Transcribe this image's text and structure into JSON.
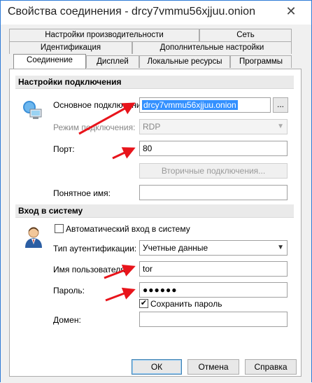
{
  "window": {
    "title": "Свойства соединения - drcy7vmmu56xjjuu.onion",
    "close_glyph": "✕"
  },
  "tabs_row1": [
    {
      "label": "Настройки производительности"
    },
    {
      "label": "Сеть"
    }
  ],
  "tabs_row2": [
    {
      "label": "Идентификация"
    },
    {
      "label": "Дополнительные настройки"
    }
  ],
  "tabs_row3": [
    {
      "label": "Соединение",
      "active": true
    },
    {
      "label": "Дисплей"
    },
    {
      "label": "Локальные ресурсы"
    },
    {
      "label": "Программы"
    }
  ],
  "connection": {
    "section_title": "Настройки подключения",
    "primary_label": "Основное подключение",
    "primary_value": "drcy7vmmu56xjjuu.onion",
    "browse_label": "...",
    "mode_label": "Режим подключения:",
    "mode_value": "RDP",
    "port_label": "Порт:",
    "port_value": "80",
    "secondary_button": "Вторичные подключения...",
    "friendly_label": "Понятное имя:",
    "friendly_value": ""
  },
  "login": {
    "section_title": "Вход в систему",
    "auto_login_label": "Автоматический вход в систему",
    "auto_login_checked": false,
    "auth_label": "Тип аутентификации:",
    "auth_value": "Учетные данные",
    "user_label": "Имя пользователя:",
    "user_value": "tor",
    "password_label": "Пароль:",
    "password_value": "●●●●●●",
    "save_password_label": "Сохранить пароль",
    "save_password_checked": true,
    "save_password_glyph": "✔",
    "domain_label": "Домен:",
    "domain_value": ""
  },
  "buttons": {
    "ok": "ОК",
    "cancel": "Отмена",
    "help": "Справка"
  },
  "colors": {
    "arrow": "#e8141b",
    "accent": "#3390ff",
    "window_border": "#2f7bd6"
  }
}
